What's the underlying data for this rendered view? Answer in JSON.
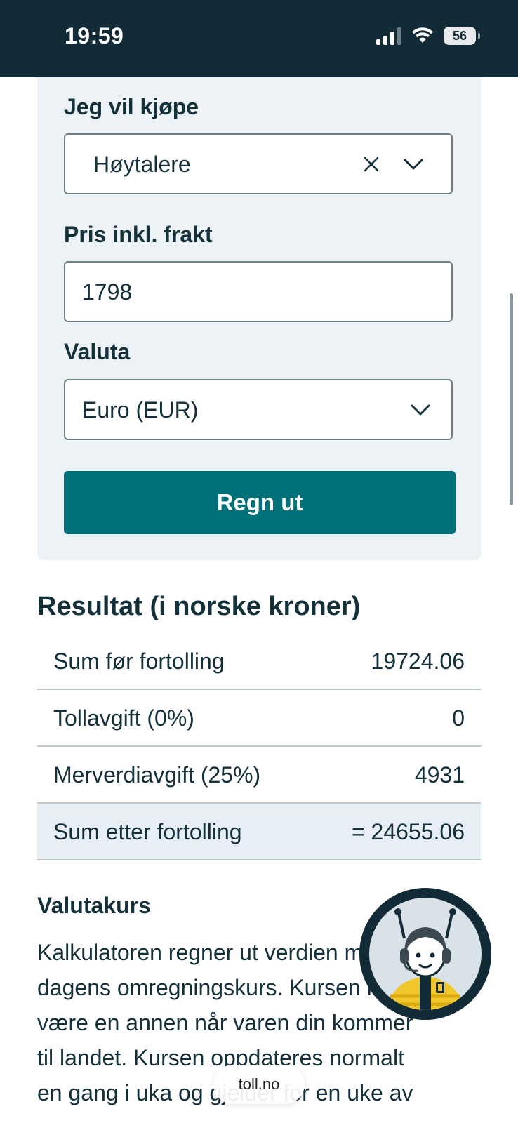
{
  "status_bar": {
    "time": "19:59",
    "battery": "56"
  },
  "form": {
    "product_label": "Jeg vil kjøpe",
    "product_value": "Høytalere",
    "price_label": "Pris inkl. frakt",
    "price_value": "1798",
    "currency_label": "Valuta",
    "currency_value": "Euro (EUR)",
    "calculate_button": "Regn ut"
  },
  "result": {
    "title": "Resultat (i norske kroner)",
    "rows": [
      {
        "label": "Sum før fortolling",
        "value": "19724.06"
      },
      {
        "label": "Tollavgift (0%)",
        "value": "0"
      },
      {
        "label": "Merverdiavgift (25%)",
        "value": "4931"
      },
      {
        "label": "Sum etter fortolling",
        "value": "= 24655.06"
      }
    ]
  },
  "exchange": {
    "heading": "Valutakurs",
    "lines": [
      "Kalkulatoren regner ut verdien med",
      "dagens omregningskurs. Kursen kan",
      "være en annen når varen din kommer",
      "til landet. Kursen oppdateres normalt",
      "en gang i uka og gjelder for en uke av"
    ]
  },
  "browser": {
    "url": "toll.no"
  },
  "colors": {
    "header": "#132b36",
    "button": "#007179",
    "panel": "#ecf2f5",
    "total_row": "#e8eef6"
  },
  "icons": {
    "clear": "close-icon",
    "dropdown": "chevron-down-icon",
    "chatbot": "chatbot-avatar-icon"
  }
}
